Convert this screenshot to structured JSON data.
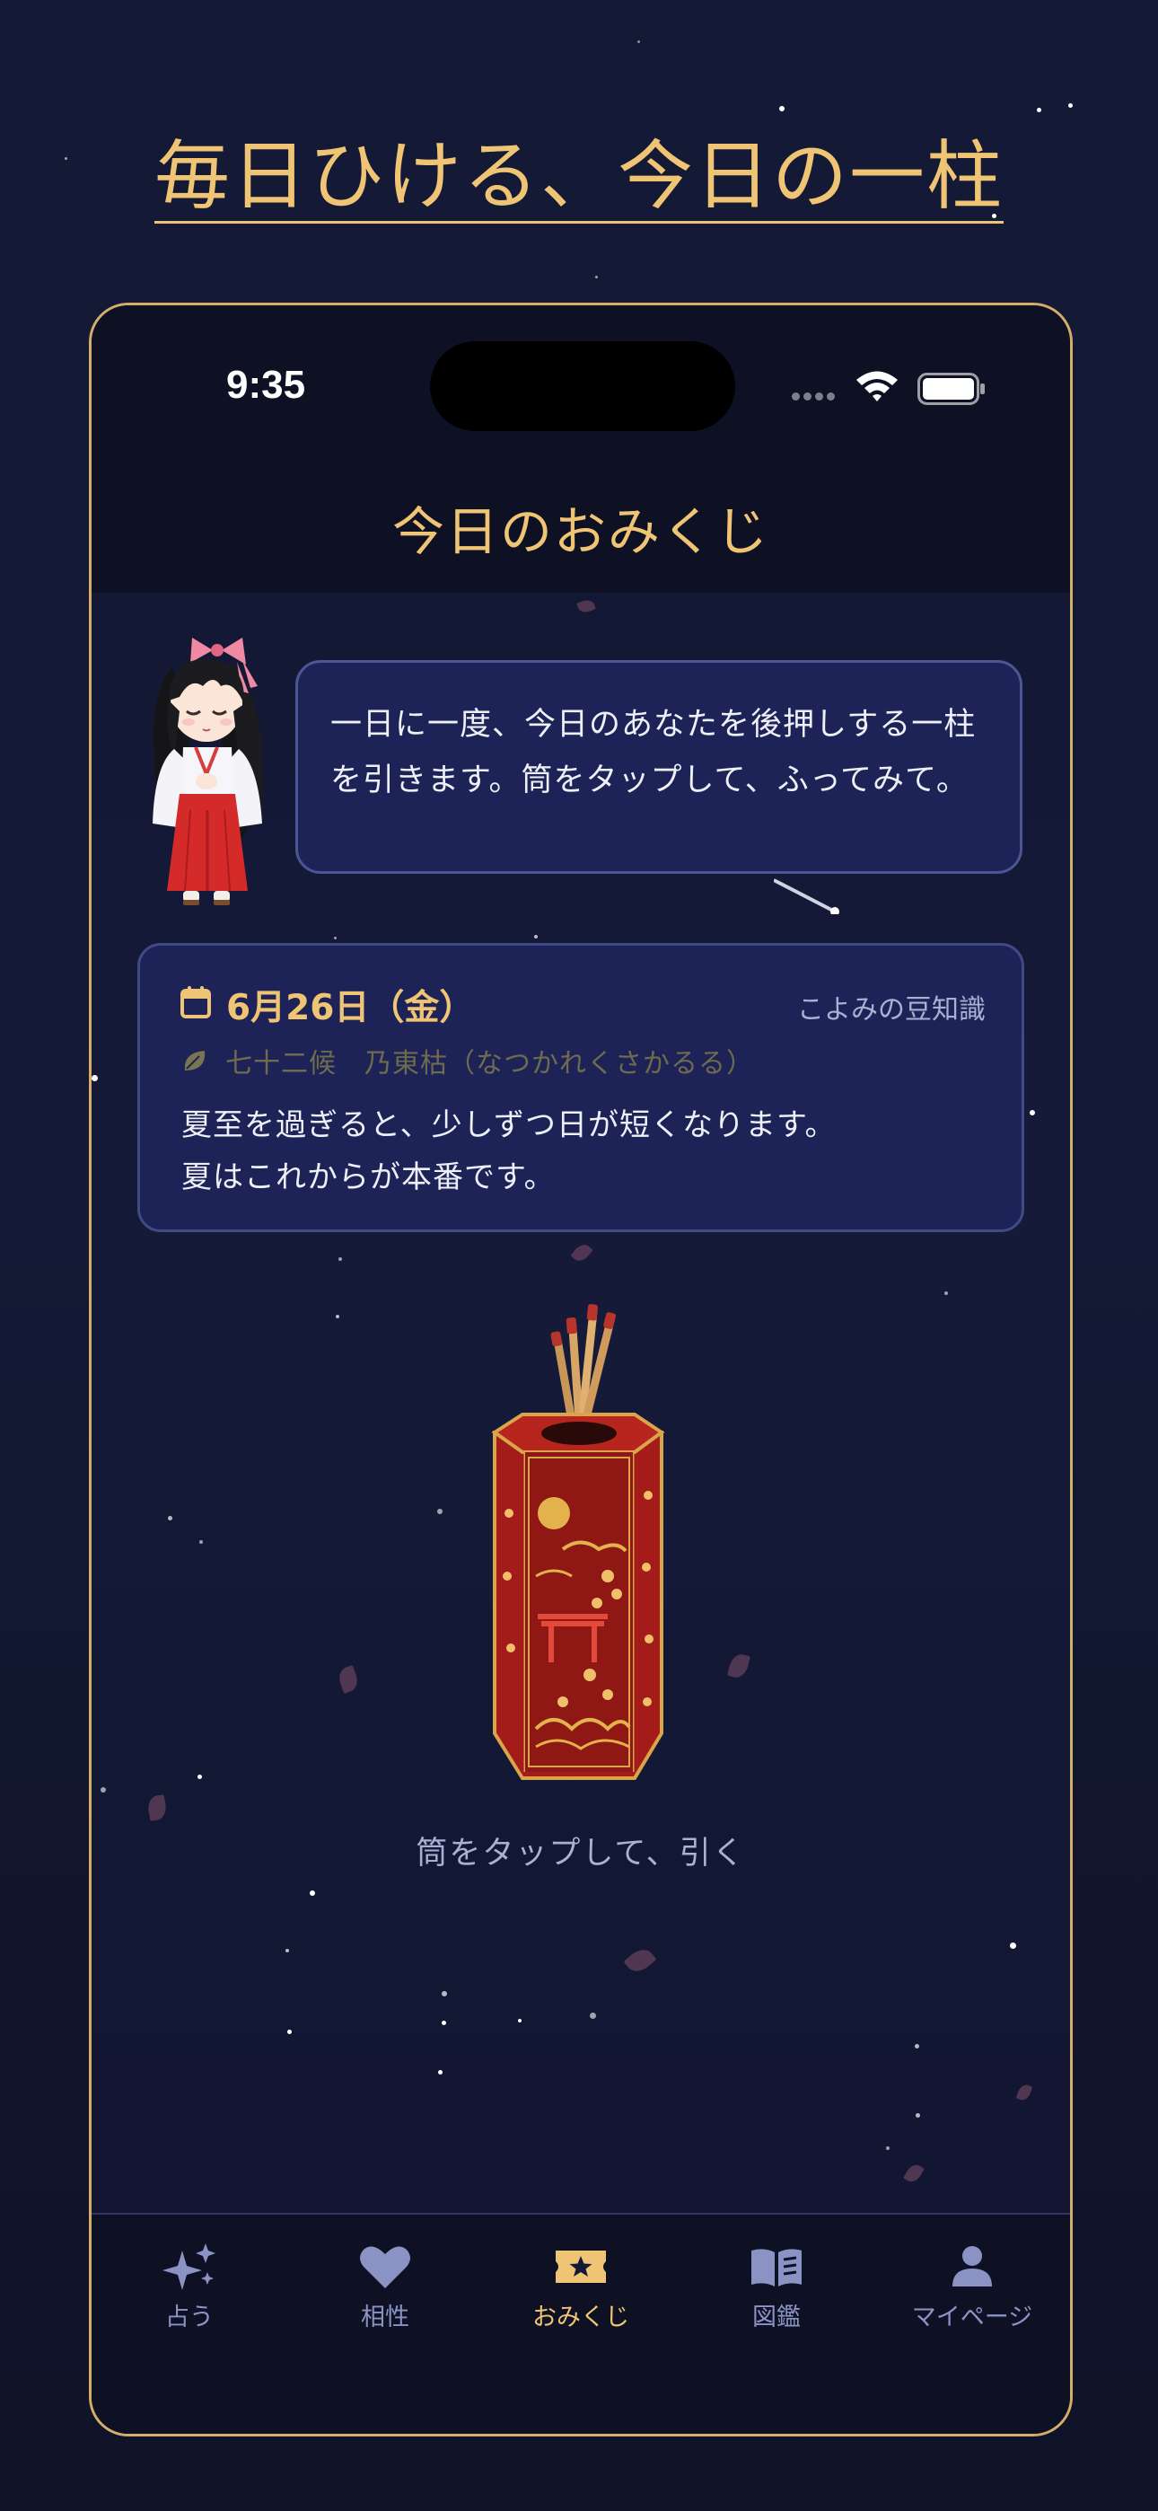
{
  "headline": "毎日ひける、今日の一柱",
  "status_bar": {
    "time": "9:35"
  },
  "screen": {
    "title": "今日のおみくじ",
    "speech": "一日に一度、今日のあなたを後押しする一柱を引きます。筒をタップして、ふってみて。",
    "info_card": {
      "date": "6月26日（金）",
      "trivia_label": "こよみの豆知識",
      "seasonal_period": "七十二候　乃東枯（なつかれくさかるる）",
      "lines": [
        "夏至を過ぎると、少しずつ日が短くなります。",
        "夏はこれからが本番です。"
      ]
    },
    "tap_hint": "筒をタップして、引く"
  },
  "tab_bar": {
    "items": [
      {
        "label": "占う",
        "icon": "sparkles-icon",
        "active": false
      },
      {
        "label": "相性",
        "icon": "heart-icon",
        "active": false
      },
      {
        "label": "おみくじ",
        "icon": "ticket-star-icon",
        "active": true
      },
      {
        "label": "図鑑",
        "icon": "book-icon",
        "active": false
      },
      {
        "label": "マイページ",
        "icon": "person-icon",
        "active": false
      }
    ]
  },
  "colors": {
    "gold": "#efc474",
    "navy": "#141a36",
    "card": "#1d2356",
    "muted_text": "#a9b0d2",
    "tab_inactive": "#8b93c4"
  }
}
